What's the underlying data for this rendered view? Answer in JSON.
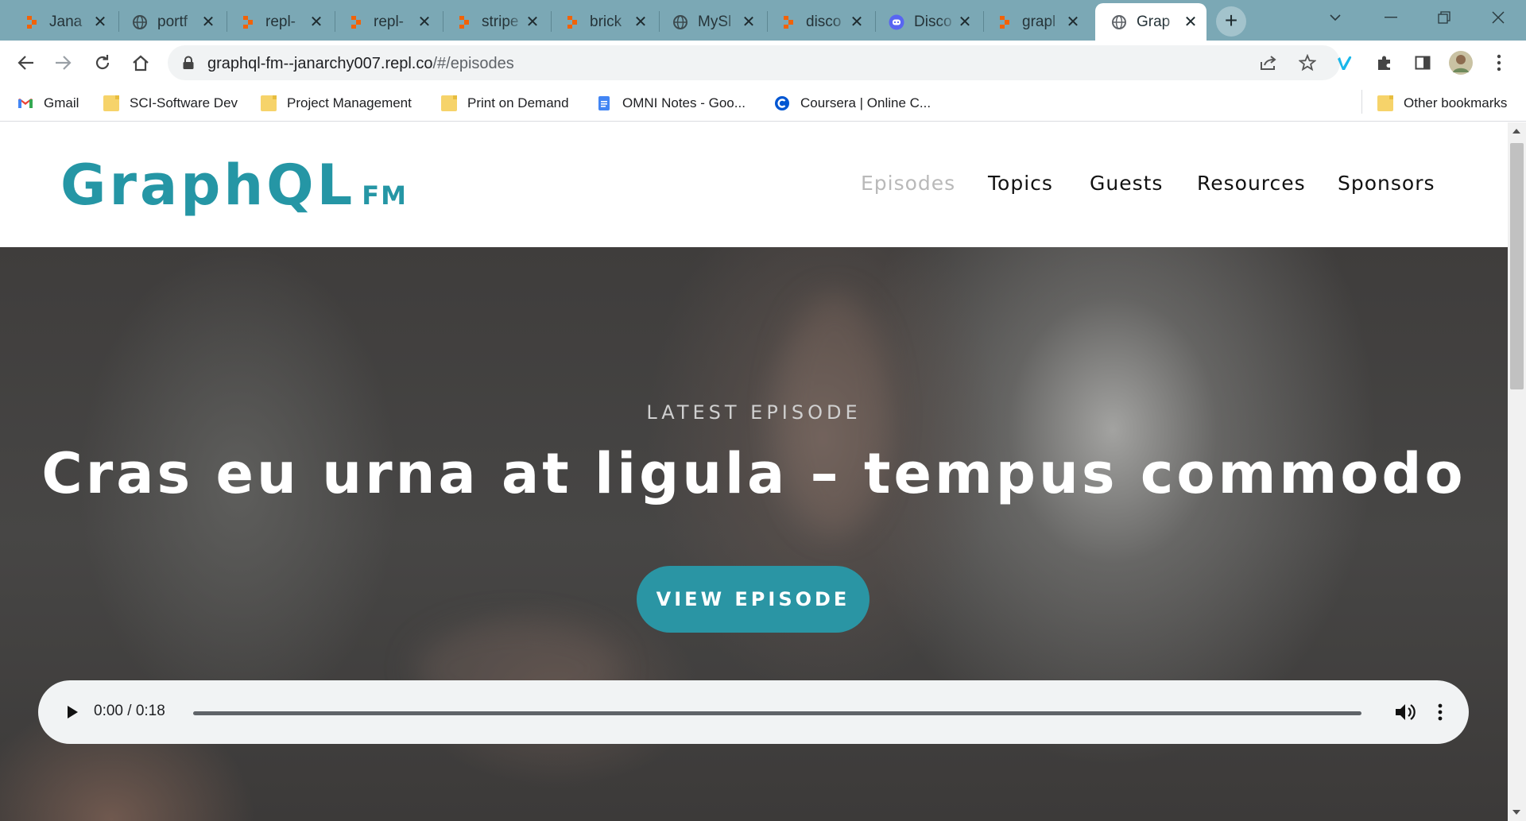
{
  "browser": {
    "tabs": [
      {
        "title": "Jana",
        "icon": "replit-icon",
        "active": false
      },
      {
        "title": "portf",
        "icon": "globe-icon",
        "active": false
      },
      {
        "title": "repl-",
        "icon": "replit-icon",
        "active": false
      },
      {
        "title": "repl-",
        "icon": "replit-icon",
        "active": false
      },
      {
        "title": "stripe",
        "icon": "replit-icon",
        "active": false
      },
      {
        "title": "brick",
        "icon": "replit-icon",
        "active": false
      },
      {
        "title": "MySl",
        "icon": "globe-icon",
        "active": false
      },
      {
        "title": "disco",
        "icon": "replit-icon",
        "active": false
      },
      {
        "title": "Disco",
        "icon": "discord-icon",
        "active": false
      },
      {
        "title": "grapl",
        "icon": "replit-icon",
        "active": false
      },
      {
        "title": "Grap",
        "icon": "globe-icon",
        "active": true
      }
    ],
    "close_glyph": "✕",
    "new_tab_glyph": "+",
    "url_host": "graphql-fm--janarchy007.repl.co",
    "url_path": "/#/episodes",
    "bookmarks": [
      {
        "label": "Gmail",
        "icon": "gmail-icon"
      },
      {
        "label": "SCI-Software Dev",
        "icon": "folder-icon"
      },
      {
        "label": "Project Management",
        "icon": "folder-icon"
      },
      {
        "label": "Print on Demand",
        "icon": "folder-icon"
      },
      {
        "label": "OMNI Notes - Goo...",
        "icon": "google-docs-icon"
      },
      {
        "label": "Coursera | Online C...",
        "icon": "coursera-icon"
      }
    ],
    "other_bookmarks": "Other bookmarks",
    "colors": {
      "tabstrip": "#7ba8b5",
      "replit_orange": "#f26207"
    }
  },
  "site": {
    "logo_main": "GraphQL",
    "logo_sub": "FM",
    "nav": [
      {
        "label": "Episodes",
        "active": true
      },
      {
        "label": "Topics",
        "active": false
      },
      {
        "label": "Guests",
        "active": false
      },
      {
        "label": "Resources",
        "active": false
      },
      {
        "label": "Sponsors",
        "active": false
      }
    ],
    "hero": {
      "kicker": "LATEST EPISODE",
      "headline": "Cras eu urna at ligula – tempus commodo",
      "player_time": "0:00 / 0:18",
      "cta": "VIEW EPISODE"
    },
    "colors": {
      "brand": "#2596a5",
      "nav_active": "#b9b9b9"
    }
  }
}
